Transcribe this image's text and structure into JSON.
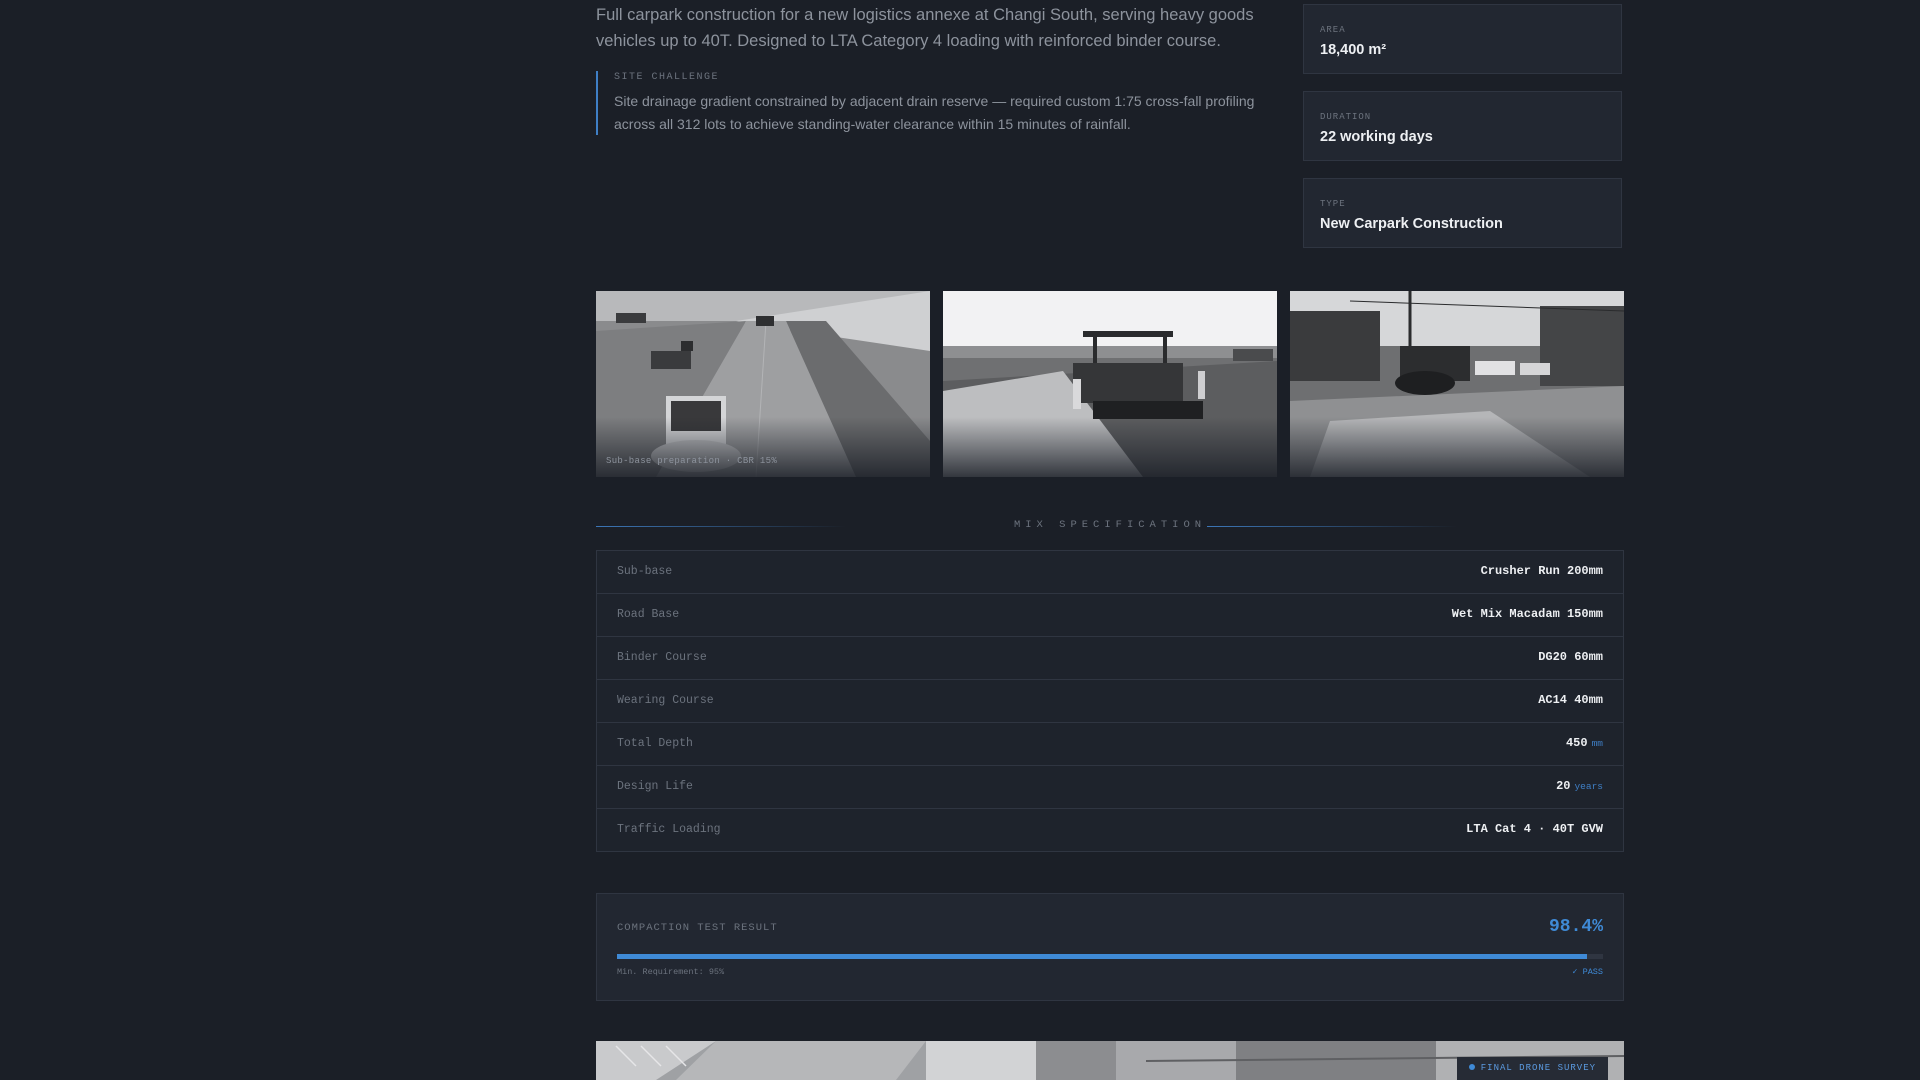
{
  "intro": {
    "description": "Full carpark construction for a new logistics annexe at Changi South, serving heavy goods vehicles up to 40T. Designed to LTA Category 4 loading with reinforced binder course.",
    "challenge_label": "SITE CHALLENGE",
    "challenge_text": "Site drainage gradient constrained by adjacent drain reserve — required custom 1:75 cross-fall profiling across all 312 lots to achieve standing-water clearance within 15 minutes of rainfall."
  },
  "stats": [
    {
      "label": "AREA",
      "value": "18,400 m²"
    },
    {
      "label": "DURATION",
      "value": "22 working days"
    },
    {
      "label": "TYPE",
      "value": "New Carpark Construction"
    }
  ],
  "photos": [
    {
      "caption": "Sub-base preparation · CBR 15%"
    },
    {
      "caption": ""
    },
    {
      "caption": ""
    }
  ],
  "mix_spec": {
    "title": "MIX SPECIFICATION",
    "rows": [
      {
        "key": "Sub-base",
        "value": "Crusher Run 200mm",
        "unit": ""
      },
      {
        "key": "Road Base",
        "value": "Wet Mix Macadam 150mm",
        "unit": ""
      },
      {
        "key": "Binder Course",
        "value": "DG20 60mm",
        "unit": ""
      },
      {
        "key": "Wearing Course",
        "value": "AC14 40mm",
        "unit": ""
      },
      {
        "key": "Total Depth",
        "value": "450",
        "unit": "mm"
      },
      {
        "key": "Design Life",
        "value": "20",
        "unit": "years"
      },
      {
        "key": "Traffic Loading",
        "value": "LTA Cat 4 · 40T GVW",
        "unit": ""
      }
    ]
  },
  "compaction": {
    "label": "COMPACTION TEST RESULT",
    "value": "98.4%",
    "progress_percent": 98.4,
    "min_requirement": "Min. Requirement: 95%",
    "status": "✓ PASS"
  },
  "drone": {
    "badge": "FINAL DRONE SURVEY"
  },
  "colors": {
    "background": "#1b1f27",
    "card": "#222731",
    "border": "#2f3541",
    "accent": "#3f8ad6",
    "text_primary": "#eef0f3",
    "text_muted": "#6c737e"
  }
}
